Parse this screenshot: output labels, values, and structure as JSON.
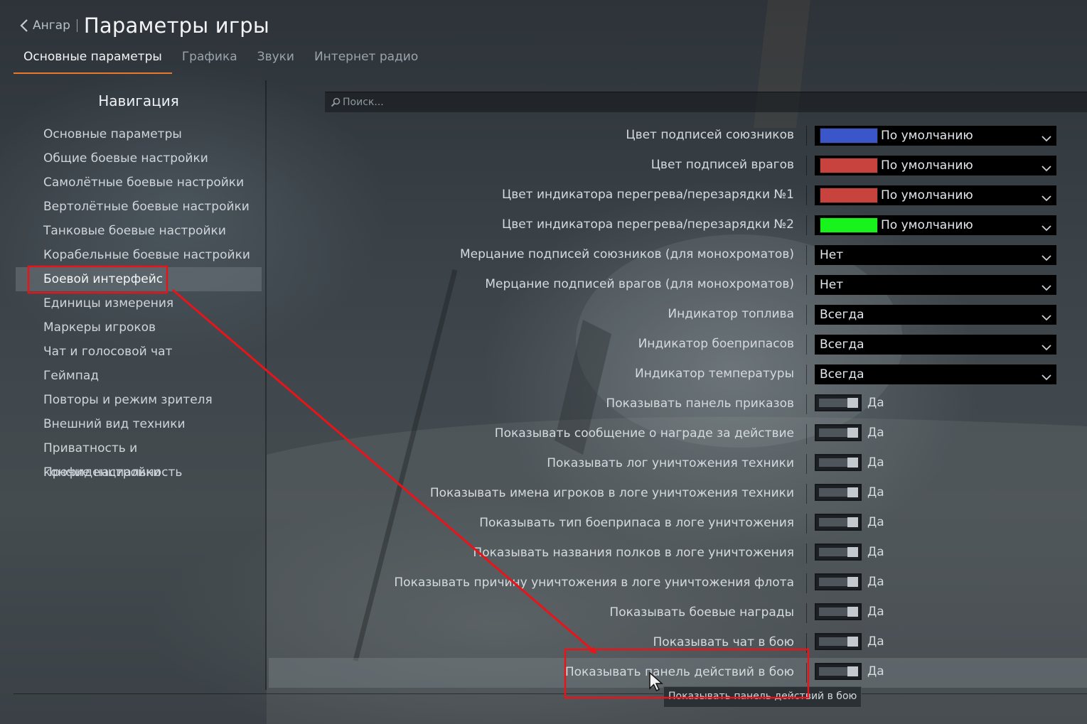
{
  "header": {
    "back_label": "Ангар",
    "title": "Параметры игры"
  },
  "tabs": [
    {
      "label": "Основные параметры",
      "active": true
    },
    {
      "label": "Графика",
      "active": false
    },
    {
      "label": "Звуки",
      "active": false
    },
    {
      "label": "Интернет радио",
      "active": false
    }
  ],
  "nav": {
    "title": "Навигация",
    "items": [
      "Основные параметры",
      "Общие боевые настройки",
      "Самолётные боевые настройки",
      "Вертолётные боевые настройки",
      "Танковые боевые настройки",
      "Корабельные боевые настройки",
      "Боевой интерфейс",
      "Единицы измерения",
      "Маркеры игроков",
      "Чат и голосовой чат",
      "Геймпад",
      "Повторы и режим зрителя",
      "Внешний вид техники",
      "Приватность и конфиденциальность",
      "Прочие настройки"
    ],
    "selected_index": 6
  },
  "search": {
    "placeholder": "Поиск..."
  },
  "settings": [
    {
      "label": "Цвет подписей союзников",
      "type": "color",
      "color": "#3a56c8",
      "value": "По умолчанию"
    },
    {
      "label": "Цвет подписей врагов",
      "type": "color",
      "color": "#c8433d",
      "value": "По умолчанию"
    },
    {
      "label": "Цвет индикатора перегрева/перезарядки №1",
      "type": "color",
      "color": "#c8433d",
      "value": "По умолчанию"
    },
    {
      "label": "Цвет индикатора перегрева/перезарядки №2",
      "type": "color",
      "color": "#19f31c",
      "value": "По умолчанию"
    },
    {
      "label": "Мерцание подписей союзников (для монохроматов)",
      "type": "select",
      "value": "Нет"
    },
    {
      "label": "Мерцание подписей врагов (для монохроматов)",
      "type": "select",
      "value": "Нет"
    },
    {
      "label": "Индикатор топлива",
      "type": "select",
      "value": "Всегда"
    },
    {
      "label": "Индикатор боеприпасов",
      "type": "select",
      "value": "Всегда"
    },
    {
      "label": "Индикатор температуры",
      "type": "select",
      "value": "Всегда"
    },
    {
      "label": "Показывать панель приказов",
      "type": "toggle",
      "value": "Да"
    },
    {
      "label": "Показывать сообщение о награде за действие",
      "type": "toggle",
      "value": "Да"
    },
    {
      "label": "Показывать лог уничтожения техники",
      "type": "toggle",
      "value": "Да"
    },
    {
      "label": "Показывать имена игроков в логе уничтожения техники",
      "type": "toggle",
      "value": "Да"
    },
    {
      "label": "Показывать тип боеприпаса в логе уничтожения",
      "type": "toggle",
      "value": "Да"
    },
    {
      "label": "Показывать названия полков в логе уничтожения",
      "type": "toggle",
      "value": "Да"
    },
    {
      "label": "Показывать причину уничтожения в логе уничтожения флота",
      "type": "toggle",
      "value": "Да"
    },
    {
      "label": "Показывать боевые награды",
      "type": "toggle",
      "value": "Да"
    },
    {
      "label": "Показывать чат в бою",
      "type": "toggle",
      "value": "Да"
    },
    {
      "label": "Показывать панель действий в бою",
      "type": "toggle",
      "value": "Да",
      "highlighted": true
    }
  ],
  "tooltip": "Показывать панель действий в бою",
  "colors": {
    "tab_accent": "#e87a2e",
    "annotation": "#e8141a"
  }
}
